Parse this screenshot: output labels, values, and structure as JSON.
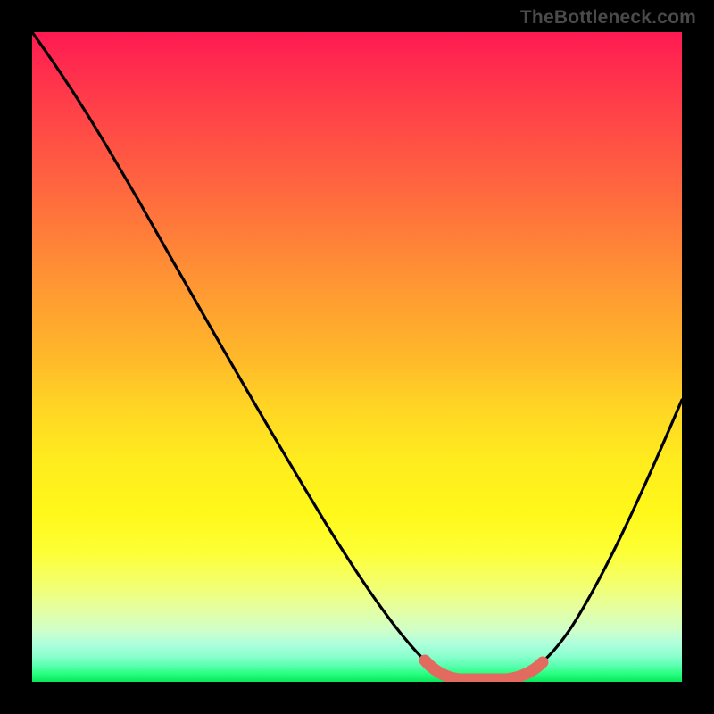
{
  "watermark": "TheBottleneck.com",
  "chart_data": {
    "type": "line",
    "title": "",
    "xlabel": "",
    "ylabel": "",
    "xlim": [
      0,
      100
    ],
    "ylim": [
      0,
      100
    ],
    "series": [
      {
        "name": "bottleneck-curve",
        "color": "#000000",
        "x": [
          0,
          10,
          20,
          30,
          40,
          50,
          56,
          60,
          64,
          67,
          70,
          74,
          80,
          86,
          92,
          100
        ],
        "values": [
          100,
          90,
          76,
          62,
          48,
          34,
          22,
          13,
          6,
          2,
          0,
          0,
          3,
          13,
          28,
          52
        ]
      },
      {
        "name": "trough-highlight",
        "color": "#e26a5f",
        "x": [
          61,
          66,
          70,
          74,
          78
        ],
        "values": [
          4,
          1,
          0,
          0,
          2
        ]
      }
    ],
    "background_gradient": {
      "top": "#ff1a52",
      "mid": "#ffd624",
      "bottom": "#07e85d"
    }
  }
}
